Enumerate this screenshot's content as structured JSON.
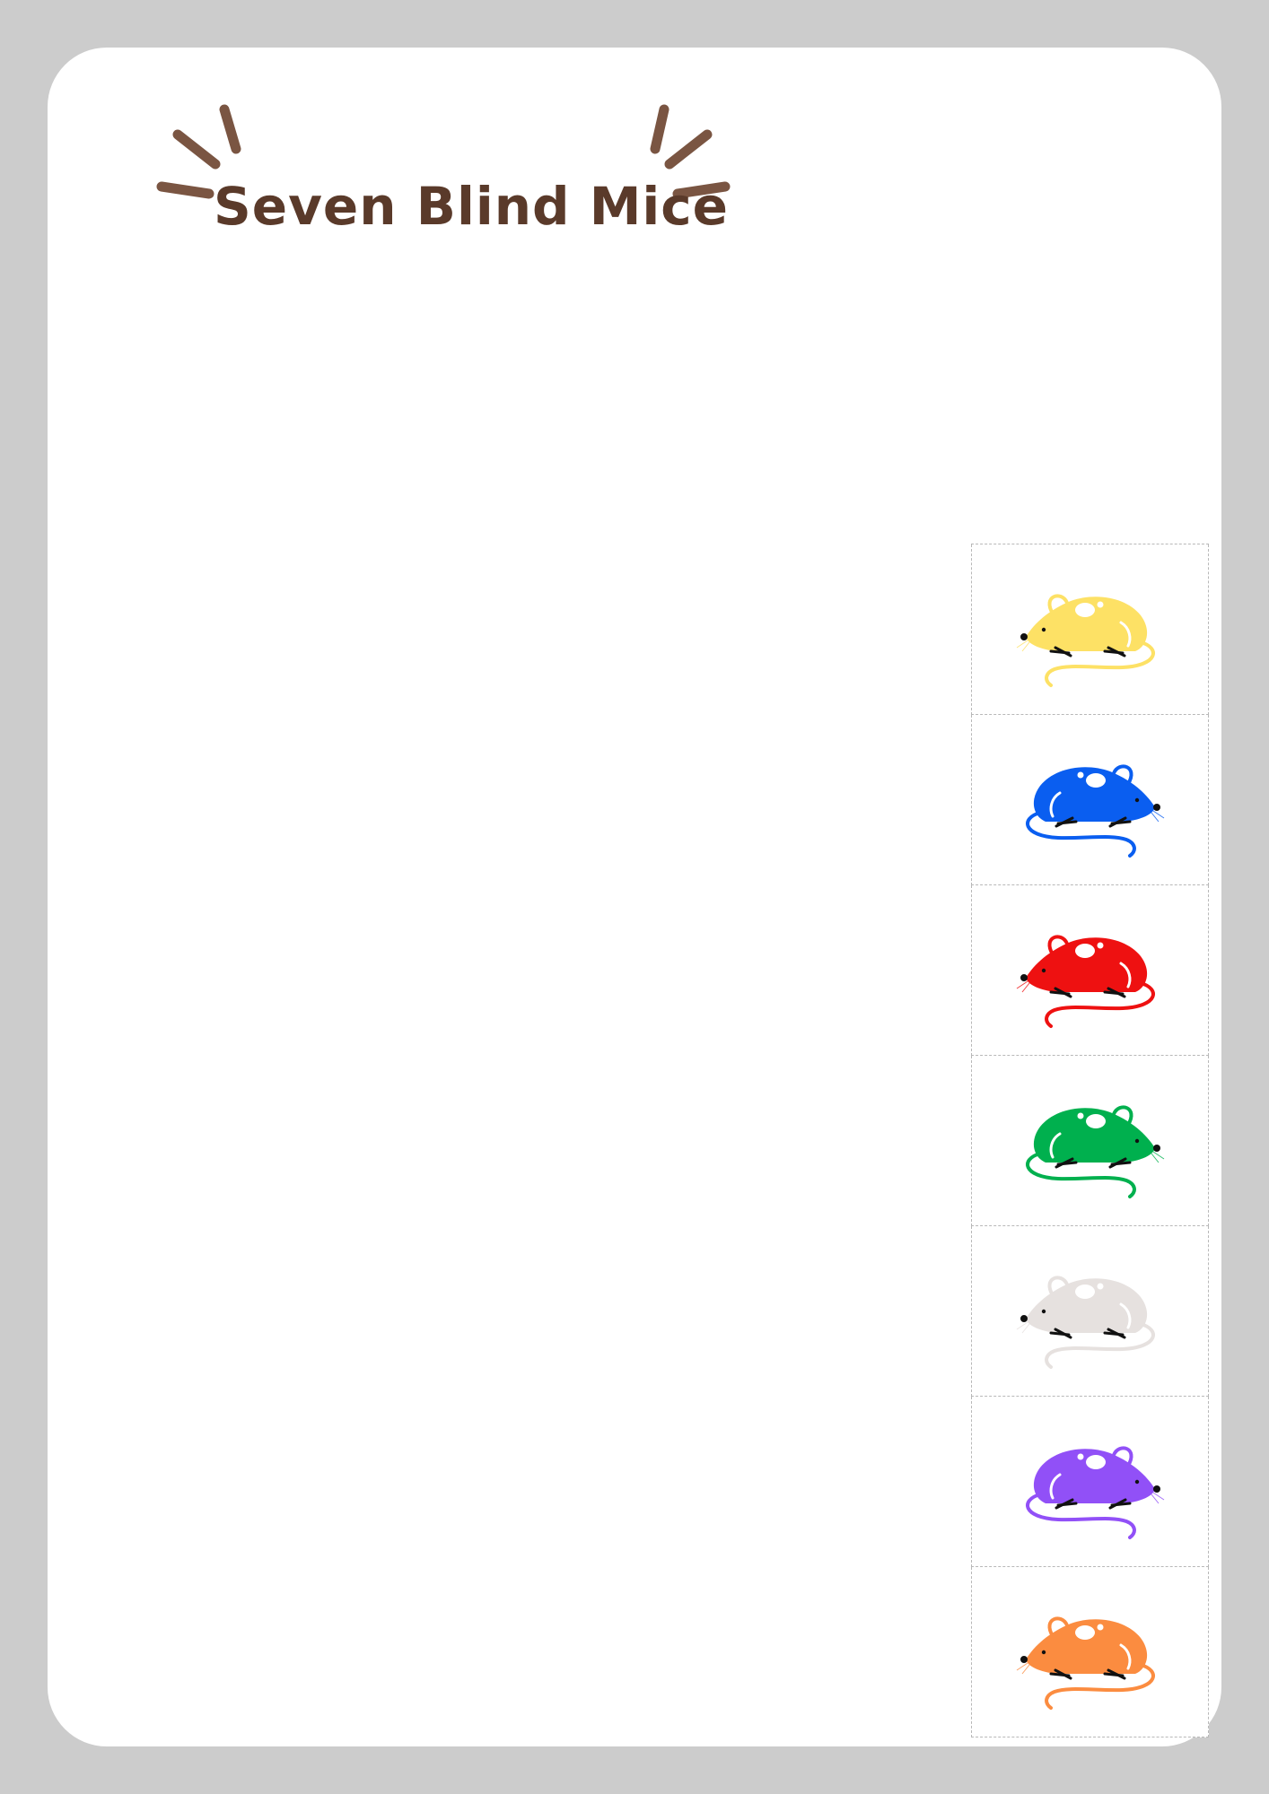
{
  "page": {
    "title": "Seven Blind Mice"
  },
  "mice": [
    {
      "name": "yellow-mouse",
      "color": "#fde165",
      "facing": "left"
    },
    {
      "name": "blue-mouse",
      "color": "#0a5ef0",
      "facing": "right"
    },
    {
      "name": "red-mouse",
      "color": "#ee1111",
      "facing": "left"
    },
    {
      "name": "green-mouse",
      "color": "#00b04e",
      "facing": "right"
    },
    {
      "name": "white-mouse",
      "color": "#e6e1df",
      "facing": "left"
    },
    {
      "name": "purple-mouse",
      "color": "#9150f7",
      "facing": "right"
    },
    {
      "name": "orange-mouse",
      "color": "#fb8c40",
      "facing": "left"
    }
  ],
  "colors": {
    "background": "#cccccc",
    "sheet": "#ffffff",
    "title_text": "#5a3a2a",
    "title_rays": "#7a5542"
  }
}
